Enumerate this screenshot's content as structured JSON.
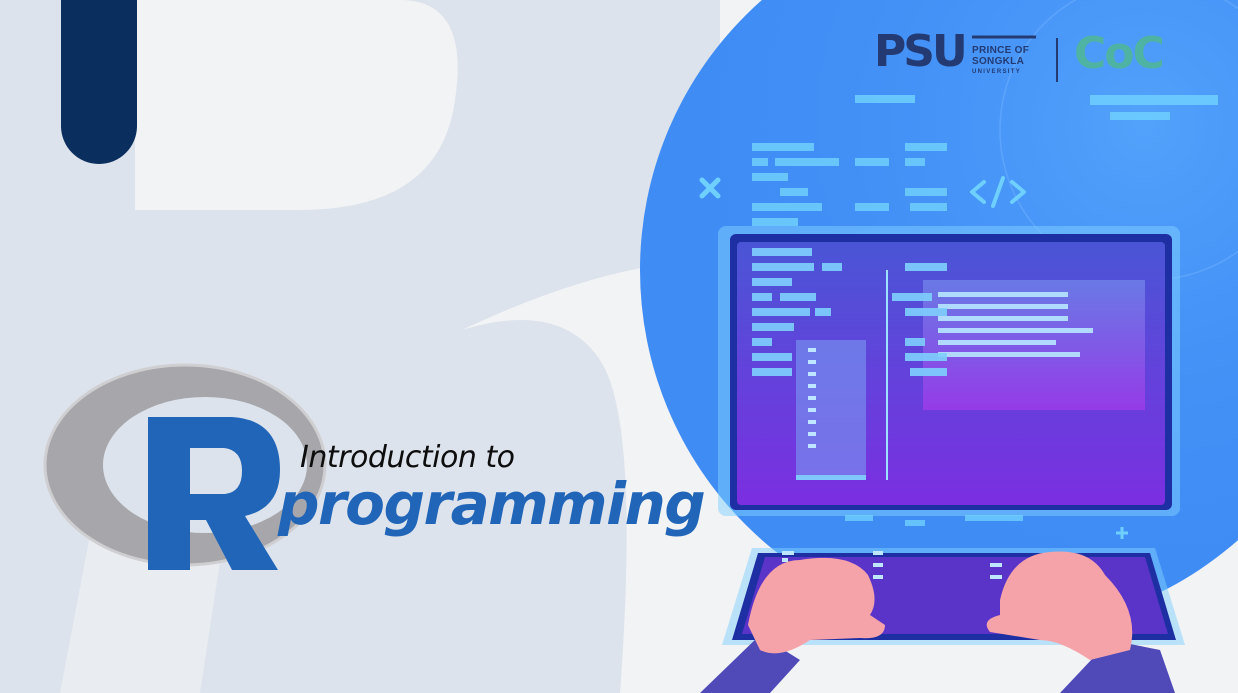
{
  "title": {
    "line1": "Introduction to",
    "line2": "programming"
  },
  "logos": {
    "psu_mark": "PSU",
    "psu_name_line1": "PRINCE OF",
    "psu_name_line2": "SONGKLA",
    "psu_name_line3": "UNIVERSITY",
    "coc_mark": "CoC"
  },
  "icons": [
    "r-logo-icon",
    "laptop-illustration",
    "close-icon",
    "code-tag-icon",
    "plus-icon"
  ],
  "colors": {
    "background": "#f2f3f5",
    "left_panel": "#dde3ec",
    "navy_bar": "#0a2f5e",
    "blue_circle": "#3f8cf5",
    "r_blue": "#2165b8",
    "r_ring": "#a7a7ab",
    "screen_purple": "#5a33c9",
    "skin": "#f5a3a8",
    "sleeve": "#4f4ab8"
  }
}
